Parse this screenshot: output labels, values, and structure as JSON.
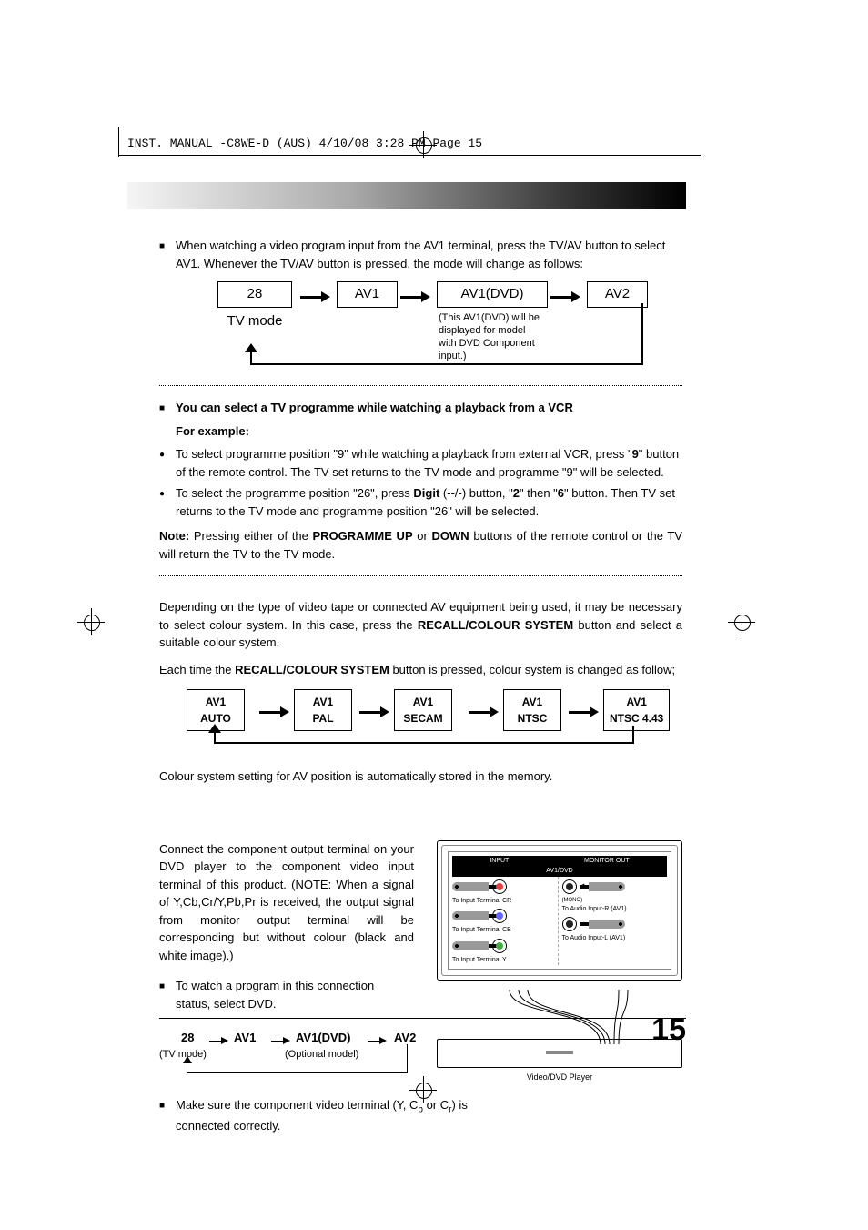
{
  "header_line": "INST. MANUAL -C8WE-D (AUS)  4/10/08  3:28 PM  Page 15",
  "intro": "When watching a video program input from the AV1 terminal, press the TV/AV button to select AV1. Whenever the TV/AV button is pressed, the mode will change as follows:",
  "flow1": {
    "n1": "28",
    "n1_sub": "TV mode",
    "n2": "AV1",
    "n3": "AV1(DVD)",
    "n3_note": "(This AV1(DVD) will be displayed for model with DVD Component input.)",
    "n4": "AV2"
  },
  "section2_heading": "You can select a TV programme while watching a playback from a VCR",
  "for_example": "For example:",
  "bullet1a": "To select programme position \"9\" while watching a playback from external VCR, press \"",
  "bullet1b": "9",
  "bullet1c": "\" button of the remote control. The TV set returns to the TV mode and programme \"9\" will be selected.",
  "bullet2a": "To select the programme position \"26\", press ",
  "bullet2b": "Digit",
  "bullet2c": " (--/-) button, \"",
  "bullet2d": "2",
  "bullet2e": "\" then \"",
  "bullet2f": "6",
  "bullet2g": "\" button. Then TV set returns to the TV mode and programme position \"26\" will be selected.",
  "note_label": "Note:",
  "note_a": " Pressing either of the ",
  "note_b": "PROGRAMME UP",
  "note_c": " or ",
  "note_d": "DOWN",
  "note_e": " buttons of the remote control or the TV will return the TV to the TV mode.",
  "colour_p1a": "Depending on the type of  video tape or connected AV equipment being used, it may be necessary to select colour system. In this case, press the ",
  "colour_p1b": "RECALL/COLOUR SYSTEM",
  "colour_p1c": " button and select a suitable colour system.",
  "colour_p2a": "Each time the ",
  "colour_p2b": "RECALL/COLOUR SYSTEM",
  "colour_p2c": " button is pressed, colour system is changed as follow;",
  "cflow": {
    "c1a": "AV1",
    "c1b": "AUTO",
    "c2a": "AV1",
    "c2b": "PAL",
    "c3a": "AV1",
    "c3b": "SECAM",
    "c4a": "AV1",
    "c4b": "NTSC",
    "c5a": "AV1",
    "c5b": "NTSC 4.43"
  },
  "colour_p3": "Colour system setting for AV position is automatically stored in the memory.",
  "comp_p1": "Connect the component output terminal on your DVD player to the component video input terminal of this product. (NOTE: When a signal of Y,Cb,Cr/Y,Pb,Pr is received, the output signal from monitor output terminal will be corresponding but without colour (black and white image).)",
  "comp_bullet1": "To watch a program in this connection status,  select DVD.",
  "flow2": {
    "n1": "28",
    "n1_sub": "(TV mode)",
    "n2": "AV1",
    "n3": "AV1(DVD)",
    "n3_sub": "(Optional model)",
    "n4": "AV2"
  },
  "comp_bullet2a": "Make sure the component video terminal (Y, C",
  "comp_bullet2b": "b",
  "comp_bullet2c": " or C",
  "comp_bullet2d": "r",
  "comp_bullet2e": ") is connected correctly.",
  "diagram": {
    "head_l": "INPUT",
    "head_r": "MONITOR OUT",
    "head_sub": "AV1/DVD",
    "row1": "To Input Terminal CR",
    "row2": "To Input Terminal CB",
    "row3": "To Input Terminal  Y",
    "aud_r": "To Audio Input-R (AV1)",
    "aud_l": "To Audio Input-L (AV1)",
    "mono": "(MONO)",
    "player": "Video/DVD Player"
  },
  "page_number": "15"
}
